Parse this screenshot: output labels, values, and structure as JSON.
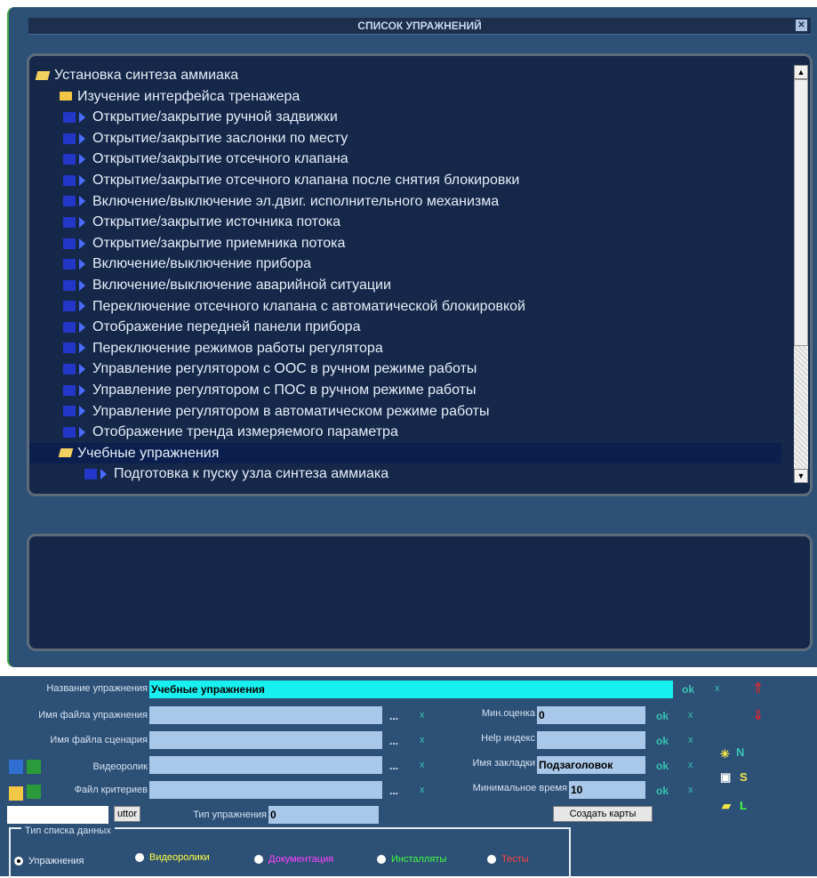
{
  "window": {
    "title": "СПИСОК УПРАЖНЕНИЙ",
    "close_glyph": "✕"
  },
  "tree": {
    "root": "Установка синтеза аммиака",
    "group1": "Изучение интерфейса тренажера",
    "items": [
      "Открытие/закрытие ручной задвижки",
      "Открытие/закрытие заслонки по месту",
      "Открытие/закрытие отсечного клапана",
      "Открытие/закрытие отсечного клапана после снятия блокировки",
      "Включение/выключение эл.двиг. исполнительного механизма",
      "Открытие/закрытие источника потока",
      "Открытие/закрытие приемника потока",
      "Включение/выключение прибора",
      "Включение/выключение аварийной ситуации",
      "Переключение отсечного клапана с автоматической блокировкой",
      "Отображение передней панели прибора",
      "Переключение режимов работы регулятора",
      "Управление регулятором с ООС в ручном режиме работы",
      "Управление регулятором с ПОС в ручном режиме работы",
      "Управление регулятором в автоматическом режиме работы",
      "Отображение тренда измеряемого параметра"
    ],
    "group2": "Учебные упражнения",
    "group2_item": "Подготовка к пуску узла синтеза  аммиака"
  },
  "form": {
    "name_label": "Название упражнения",
    "name_value": "Учебные упражнения",
    "file_label": "Имя файла упражнения",
    "scenario_label": "Имя файла сценария",
    "video_label": "Видеоролик",
    "criteria_label": "Файл критериев",
    "type_label": "Тип упражнения",
    "type_value": "0",
    "min_score_label": "Мин.оценка",
    "min_score_value": "0",
    "help_label": "Help индекс",
    "help_value": "",
    "bookmark_label": "Имя закладки",
    "bookmark_value": "Подзаголовок",
    "min_time_label": "Минимальное время",
    "min_time_value": "10",
    "dots": "...",
    "ok": "ok",
    "x": "x",
    "editor_button": "uttor",
    "create_maps_button": "Создать карты",
    "side_n": "N",
    "side_s": "S",
    "side_l": "L"
  },
  "datatype": {
    "legend": "Тип списка данных",
    "options": [
      {
        "label": "Упражнения",
        "color": "#e6edf7",
        "selected": true
      },
      {
        "label": "Видеоролики",
        "color": "#ffff40",
        "selected": false
      },
      {
        "label": "Документация",
        "color": "#ff40ff",
        "selected": false
      },
      {
        "label": "Инсталляты",
        "color": "#40ff40",
        "selected": false
      },
      {
        "label": "Тесты",
        "color": "#ff4040",
        "selected": false
      }
    ]
  }
}
